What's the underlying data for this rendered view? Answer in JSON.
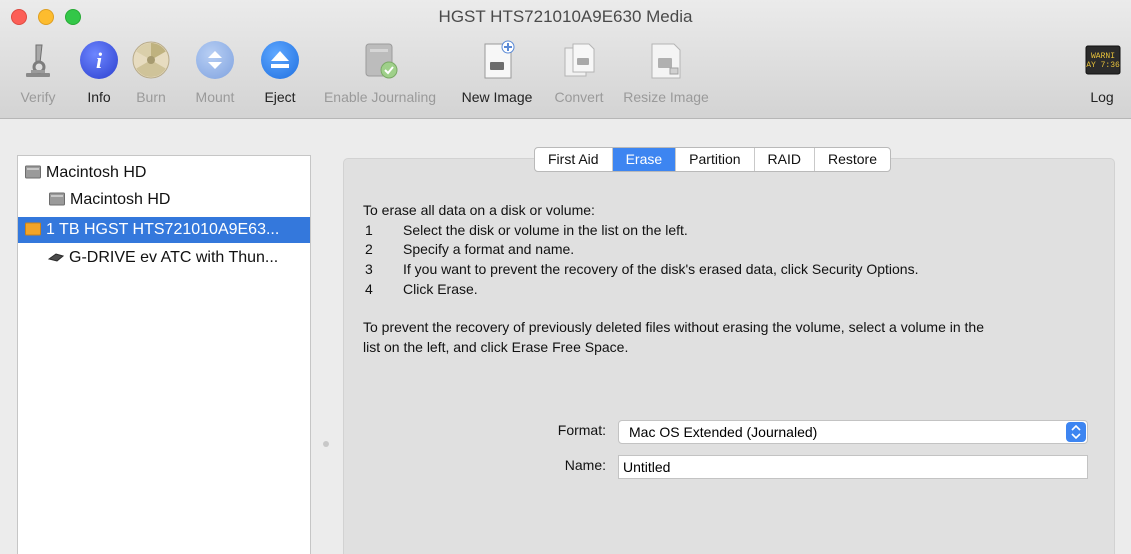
{
  "window": {
    "title": "HGST HTS721010A9E630 Media"
  },
  "toolbar": {
    "verify": "Verify",
    "info": "Info",
    "burn": "Burn",
    "mount": "Mount",
    "eject": "Eject",
    "enable_journaling": "Enable Journaling",
    "new_image": "New Image",
    "convert": "Convert",
    "resize_image": "Resize Image",
    "log": "Log",
    "log_icon_text": [
      "WARNI",
      "AY 7:36"
    ]
  },
  "sidebar": {
    "items": [
      {
        "label": "Macintosh HD",
        "icon": "hard-disk-icon"
      },
      {
        "label": "Macintosh HD",
        "icon": "volume-icon"
      },
      {
        "label": "1 TB HGST HTS721010A9E63...",
        "icon": "external-disk-icon",
        "selected": true
      },
      {
        "label": "G-DRIVE ev ATC with Thun...",
        "icon": "drive-icon"
      }
    ]
  },
  "tabs": [
    "First Aid",
    "Erase",
    "Partition",
    "RAID",
    "Restore"
  ],
  "active_tab": "Erase",
  "erase": {
    "intro": "To erase all data on a disk or volume:",
    "steps": [
      {
        "num": "1",
        "text": "Select the disk or volume in the list on the left."
      },
      {
        "num": "2",
        "text": "Specify a format and name."
      },
      {
        "num": "3",
        "text": "If you want to prevent the recovery of the disk's erased data, click Security Options."
      },
      {
        "num": "4",
        "text": "Click Erase."
      }
    ],
    "note_line1": "To prevent the recovery of previously deleted files without erasing the volume, select a volume in the",
    "note_line2": "list on the left, and click Erase Free Space.",
    "format_label": "Format:",
    "format_value": "Mac OS Extended (Journaled)",
    "name_label": "Name:",
    "name_value": "Untitled"
  },
  "colors": {
    "accent": "#3d85f1",
    "selection": "#3478dc"
  }
}
